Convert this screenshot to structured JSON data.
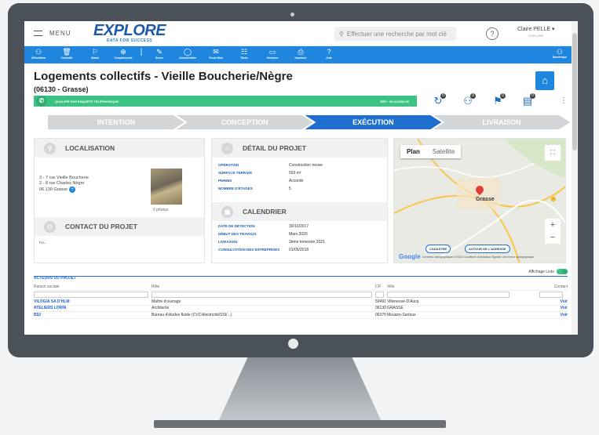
{
  "header": {
    "menu_label": "MENU",
    "logo_title": "EXPLORE",
    "logo_sub": "DATA FOR SUCCESS",
    "search_placeholder": "Effectuer une recherche par mot clé",
    "help": "?",
    "user_name": "Claire PELLE ▾",
    "user_company": "EXPLORE"
  },
  "toolbar": {
    "items": [
      {
        "icon": "person-icon",
        "glyph": "⚇",
        "label": "Affectation"
      },
      {
        "icon": "trash-icon",
        "glyph": "🗑",
        "label": "Corbeille"
      },
      {
        "icon": "flag-icon",
        "glyph": "⚐",
        "label": "Statut"
      },
      {
        "icon": "plus-circle-icon",
        "glyph": "⊕",
        "label": "Compléments"
      },
      {
        "icon": "pencil-icon",
        "glyph": "✎",
        "label": "Scène"
      },
      {
        "icon": "comment-icon",
        "glyph": "◯",
        "label": "Commentaire"
      },
      {
        "icon": "mail-icon",
        "glyph": "✉",
        "label": "Envoi Mail"
      },
      {
        "icon": "task-icon",
        "glyph": "☷",
        "label": "Tâche"
      },
      {
        "icon": "folder-icon",
        "glyph": "▭",
        "label": "Dossiers"
      },
      {
        "icon": "print-icon",
        "glyph": "⎙",
        "label": "Imprimer"
      },
      {
        "icon": "help-icon",
        "glyph": "?",
        "label": "Aide"
      }
    ],
    "right_label": "Numérique",
    "right_glyph": "⚇"
  },
  "page": {
    "title": "Logements collectifs - Vieille Boucherie/Nègre",
    "subtitle": "(06130 - Grasse)"
  },
  "status": {
    "text": "QUALIFIÉ PAR ENQUÊTE TÉLÉPHONIQUE",
    "ref": "RÉF : 09-213282-06",
    "icon_badges": [
      "0",
      "0",
      "0",
      "0"
    ]
  },
  "steps": [
    "INTENTION",
    "CONCEPTION",
    "EXÉCUTION",
    "LIVRAISON"
  ],
  "localisation": {
    "title": "LOCALISATION",
    "address": [
      "3 - 7 rue Vieille Boucherie",
      "2 - 8 rue Charles Nègre",
      "06 130 Grasse"
    ],
    "photos": "2 photos"
  },
  "contact": {
    "title": "CONTACT DU PROJET",
    "value": "n.c."
  },
  "detail": {
    "title": "DÉTAIL DU PROJET",
    "rows": [
      {
        "k": "OPÉRATION",
        "v": "Construction neuve"
      },
      {
        "k": "SURFACE TERRAIN",
        "v": "593 m²"
      },
      {
        "k": "PERMIS",
        "v": "Accordé"
      },
      {
        "k": "NOMBRE D'ÉTAGES",
        "v": "5"
      }
    ]
  },
  "calendar": {
    "title": "CALENDRIER",
    "rows": [
      {
        "k": "DATE DE DÉTECTION",
        "v": "30/10/2017"
      },
      {
        "k": "DÉBUT DES TRAVAUX",
        "v": "Mars 2020"
      },
      {
        "k": "LIVRAISON",
        "v": "3ème trimestre 2021"
      },
      {
        "k": "CONSULTATION DES ENTREPRISES",
        "v": "01/05/2018"
      }
    ]
  },
  "map": {
    "tab_plan": "Plan",
    "tab_satellite": "Satellite",
    "city": "Grasse",
    "btn_cadastre": "CADASTRE",
    "btn_autour": "AUTOUR DE L'ADRESSE",
    "google": "Google",
    "footer": "Données cartographiques ©2020   Conditions d'utilisation   Signaler une erreur cartographique"
  },
  "actors": {
    "tab": "ACTEURS DU PROJET",
    "toggle_label": "Affichage Liste",
    "headers": [
      "Raison sociale",
      "Rôle",
      "CP",
      "Ville",
      "Contact"
    ],
    "rows": [
      {
        "name": "VILOGIA SA D'HLM",
        "role": "Maître d'ouvrage",
        "cp": "59491",
        "city": "Villeneuve-D'Ascq",
        "action": "Voir"
      },
      {
        "name": "ATELIERS LORIN",
        "role": "Architecte",
        "cp": "06130",
        "city": "GRASSE",
        "action": "Voir"
      },
      {
        "name": "B52",
        "role": "Bureau d'études fluide (CVC/électricité/SSI/...)",
        "cp": "06370",
        "city": "Mouans-Sartoux",
        "action": "Voir"
      }
    ]
  }
}
